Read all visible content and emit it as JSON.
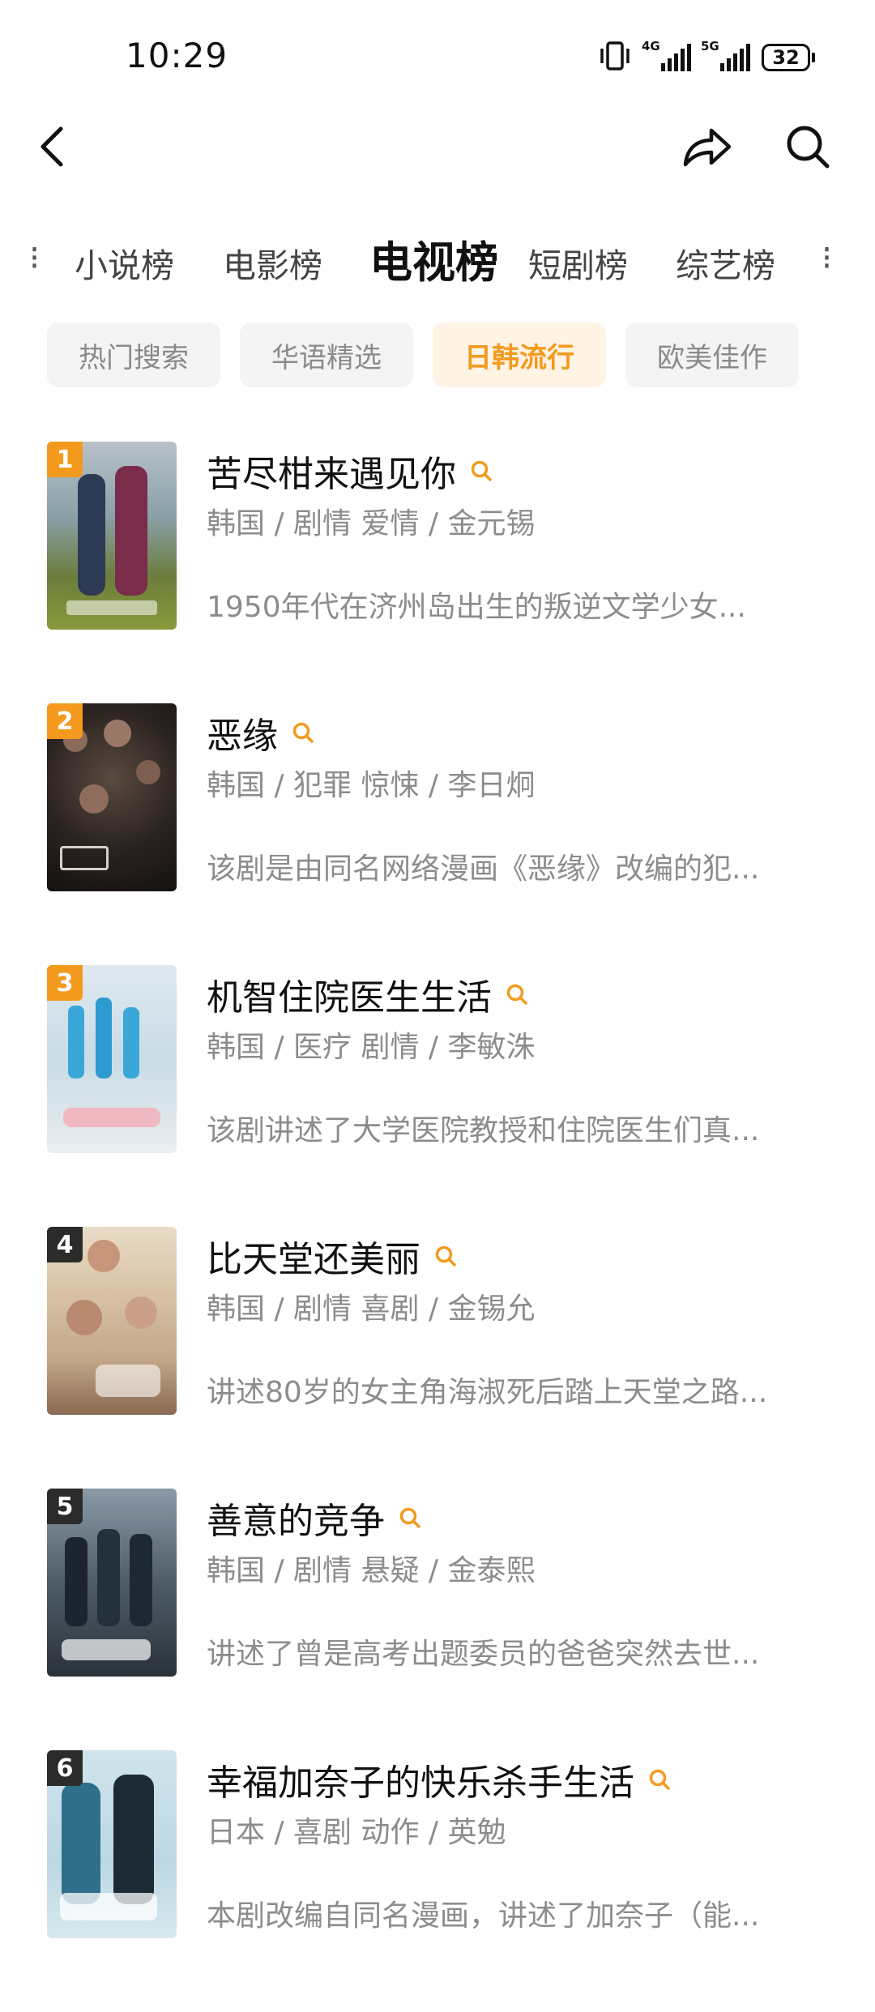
{
  "status_bar": {
    "time": "10:29",
    "signal1_label": "4G",
    "signal2_label": "5G",
    "battery": "32"
  },
  "nav": {
    "back_icon": "chevron-left-icon",
    "share_icon": "share-arrow-icon",
    "search_icon": "search-icon"
  },
  "category_tabs": [
    "小说榜",
    "电影榜",
    "电视榜",
    "短剧榜",
    "综艺榜"
  ],
  "active_category": "电视榜",
  "chips": [
    "热门搜索",
    "华语精选",
    "日韩流行",
    "欧美佳作"
  ],
  "active_chip": "日韩流行",
  "colors": {
    "accent": "#f39a1e",
    "chip_bg": "#f4f4f4",
    "meta_text": "#8c8c8c"
  },
  "items": [
    {
      "rank": "1",
      "title": "苦尽柑来遇见你",
      "meta": "韩国 / 剧情 爱情 / 金元锡",
      "desc": "1950年代在济州岛出生的叛逆文学少女..."
    },
    {
      "rank": "2",
      "title": "恶缘",
      "meta": "韩国 / 犯罪 惊悚 / 李日炯",
      "desc": "该剧是由同名网络漫画《恶缘》改编的犯..."
    },
    {
      "rank": "3",
      "title": "机智住院医生生活",
      "meta": "韩国 / 医疗 剧情 / 李敏洙",
      "desc": "该剧讲述了大学医院教授和住院医生们真..."
    },
    {
      "rank": "4",
      "title": "比天堂还美丽",
      "meta": "韩国 / 剧情 喜剧 / 金锡允",
      "desc": "讲述80岁的女主角海淑死后踏上天堂之路..."
    },
    {
      "rank": "5",
      "title": "善意的竞争",
      "meta": "韩国 / 剧情 悬疑 / 金泰熙",
      "desc": "讲述了曾是高考出题委员的爸爸突然去世..."
    },
    {
      "rank": "6",
      "title": "幸福加奈子的快乐杀手生活",
      "meta": "日本 / 喜剧 动作 / 英勉",
      "desc": "本剧改编自同名漫画，讲述了加奈子（能..."
    }
  ]
}
